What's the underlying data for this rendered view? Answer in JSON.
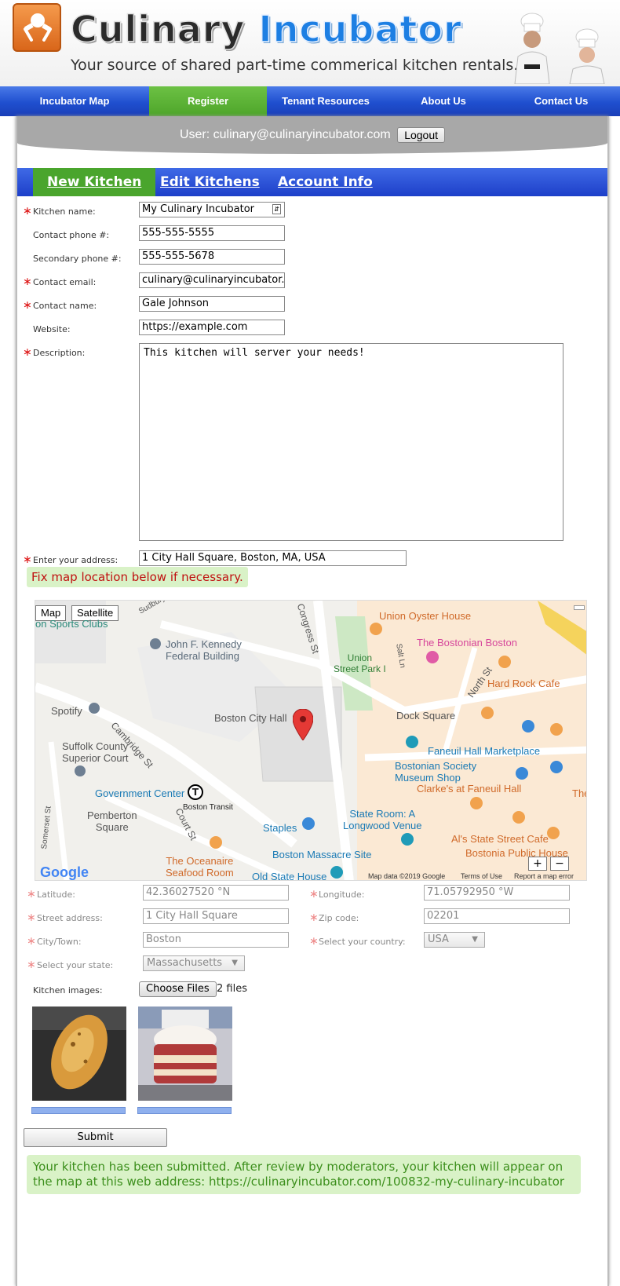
{
  "header": {
    "title_part1": "Culinary",
    "title_part2": "Incubator",
    "tagline": "Your source of shared part-time commerical kitchen rentals."
  },
  "nav": {
    "items": [
      "Incubator Map",
      "Register",
      "Tenant Resources",
      "About Us",
      "Contact Us"
    ],
    "active": "Register"
  },
  "userbar": {
    "user_text": "User: culinary@culinaryincubator.com",
    "logout_label": "Logout"
  },
  "subnav": {
    "tabs": [
      "New Kitchen",
      "Edit Kitchens",
      "Account Info"
    ],
    "active": "New Kitchen"
  },
  "form": {
    "kitchen_name": {
      "label": "Kitchen name:",
      "value": "My Culinary Incubator",
      "required": true
    },
    "contact_phone": {
      "label": "Contact phone #:",
      "value": "555-555-5555"
    },
    "secondary_phone": {
      "label": "Secondary phone #:",
      "value": "555-555-5678"
    },
    "contact_email": {
      "label": "Contact email:",
      "value": "culinary@culinaryincubator.c",
      "required": true
    },
    "contact_name": {
      "label": "Contact name:",
      "value": "Gale Johnson",
      "required": true
    },
    "website": {
      "label": "Website:",
      "value": "https://example.com"
    },
    "description": {
      "label": "Description:",
      "value": "This kitchen will server your needs!",
      "required": true
    },
    "address": {
      "label": "Enter your address:",
      "value": "1 City Hall Square, Boston, MA, USA",
      "required": true
    },
    "map_notice": "Fix map location below if necessary.",
    "latitude": {
      "label": "Latitude:",
      "value": "42.36027520 °N"
    },
    "longitude": {
      "label": "Longitude:",
      "value": "71.05792950 °W"
    },
    "street": {
      "label": "Street address:",
      "value": "1 City Hall Square"
    },
    "zip": {
      "label": "Zip code:",
      "value": "02201"
    },
    "city": {
      "label": "City/Town:",
      "value": "Boston"
    },
    "country": {
      "label": "Select your country:",
      "value": "USA"
    },
    "state": {
      "label": "Select your state:",
      "value": "Massachusetts"
    },
    "images": {
      "label": "Kitchen images:",
      "button": "Choose Files",
      "count_text": "2 files"
    },
    "submit_label": "Submit",
    "success_message": "Your kitchen has been submitted. After review by moderators, your kitchen will appear on the map at this web address: https://culinaryincubator.com/100832-my-culinary-incubator"
  },
  "map": {
    "buttons": {
      "map": "Map",
      "satellite": "Satellite"
    },
    "labels": {
      "union_oyster": "Union Oyster House",
      "bostonian": "The Bostonian Boston",
      "hard_rock": "Hard Rock Cafe",
      "union_park": "Union\nStreet Park I",
      "jfk": "John F. Kennedy\nFederal Building",
      "sports_clubs": "on Sports Clubs",
      "city_hall": "Boston City Hall",
      "spotify": "Spotify",
      "dock_square": "Dock Square",
      "faneuil": "Faneuil Hall Marketplace",
      "suffolk": "Suffolk County\nSuperior Court",
      "bostonian_society": "Bostonian Society\nMuseum Shop",
      "clarkes": "Clarke's at Faneuil Hall",
      "gov_center": "Government Center",
      "boston_transit": "Boston Transit",
      "pemberton": "Pemberton\nSquare",
      "state_room": "State Room: A\nLongwood Venue",
      "staples": "Staples",
      "als": "Al's State Street Cafe",
      "bostonia": "Bostonia Public House",
      "oceanaire": "The Oceanaire\nSeafood Room",
      "massacre": "Boston Massacre Site",
      "old_state": "Old State House",
      "the_b": "The B",
      "cambridge_st": "Cambridge St",
      "court_st": "Court St",
      "congress_st": "Congress St",
      "north_st": "North St",
      "salt_ln": "Salt Ln",
      "somerset_st": "Somerset St",
      "sudbury": "Sudbury",
      "google": "Google"
    },
    "footer": {
      "data": "Map data ©2019 Google",
      "terms": "Terms of Use",
      "report": "Report a map error"
    },
    "zoom_in": "+",
    "zoom_out": "−"
  },
  "colors": {
    "nav_blue": "#1f4fcf",
    "active_green": "#4ea52a",
    "required_red": "#d11111",
    "notice_bg": "#d9f2c7",
    "success_text": "#3c8f1c"
  }
}
